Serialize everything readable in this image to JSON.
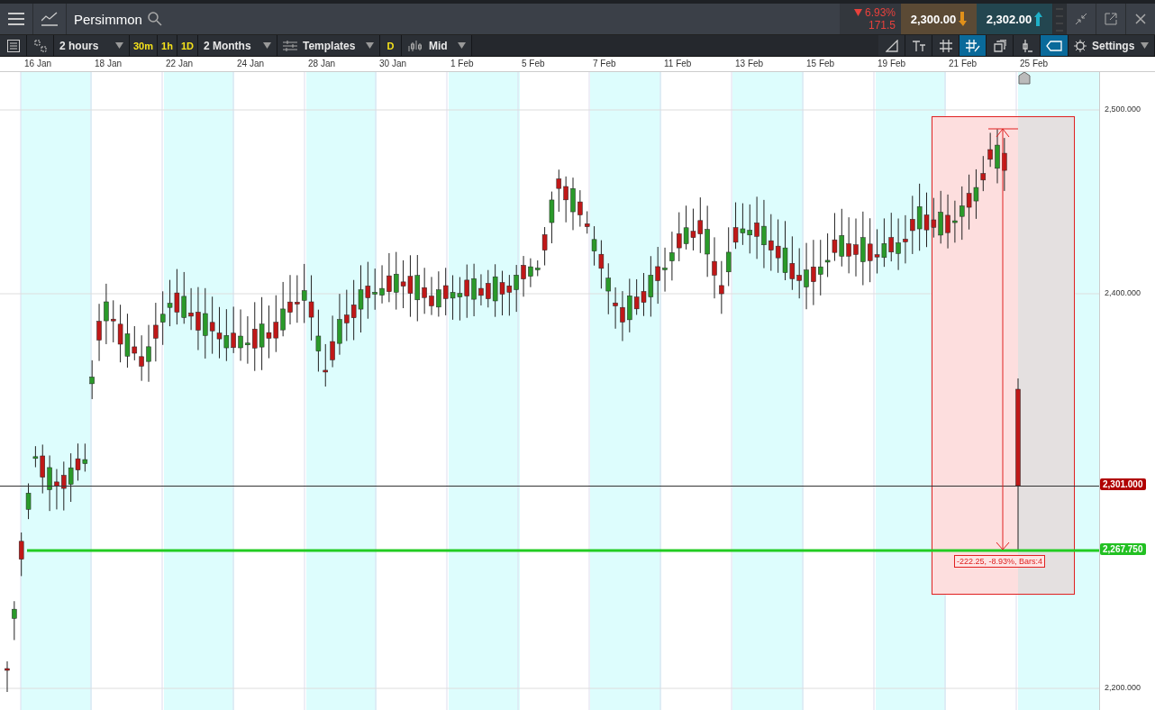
{
  "header": {
    "title": "Persimmon",
    "change_rising": false,
    "change_percent": "6.93%",
    "change_points": "171.5",
    "sell": "2,300.00",
    "sell_rising": false,
    "buy": "2,302.00",
    "buy_rising": true
  },
  "toolbar": {
    "interval": "2 hours",
    "quick_intervals": [
      "30m",
      "1h",
      "1D"
    ],
    "range": "2 Months",
    "templates": "Templates",
    "period_button": "D",
    "price_type": "Mid",
    "settings": "Settings"
  },
  "tools": [
    {
      "kind": "trendline",
      "selected": false
    },
    {
      "kind": "text",
      "selected": false
    },
    {
      "kind": "grid",
      "selected": false
    },
    {
      "kind": "snap",
      "selected": true
    },
    {
      "kind": "layers",
      "selected": false
    },
    {
      "kind": "indicator",
      "selected": false
    },
    {
      "kind": "tag",
      "selected": true
    }
  ],
  "date_axis": [
    "16 Jan",
    "18 Jan",
    "22 Jan",
    "24 Jan",
    "28 Jan",
    "30 Jan",
    "1 Feb",
    "5 Feb",
    "7 Feb",
    "11 Feb",
    "13 Feb",
    "15 Feb",
    "19 Feb",
    "21 Feb",
    "25 Feb"
  ],
  "price_axis": [
    "2,500.000",
    "2,400.000",
    "2,200.000"
  ],
  "current_price": "2,301.000",
  "support_price": "2,267.750",
  "measurement": "-222.25, -8.93%, Bars:4"
}
